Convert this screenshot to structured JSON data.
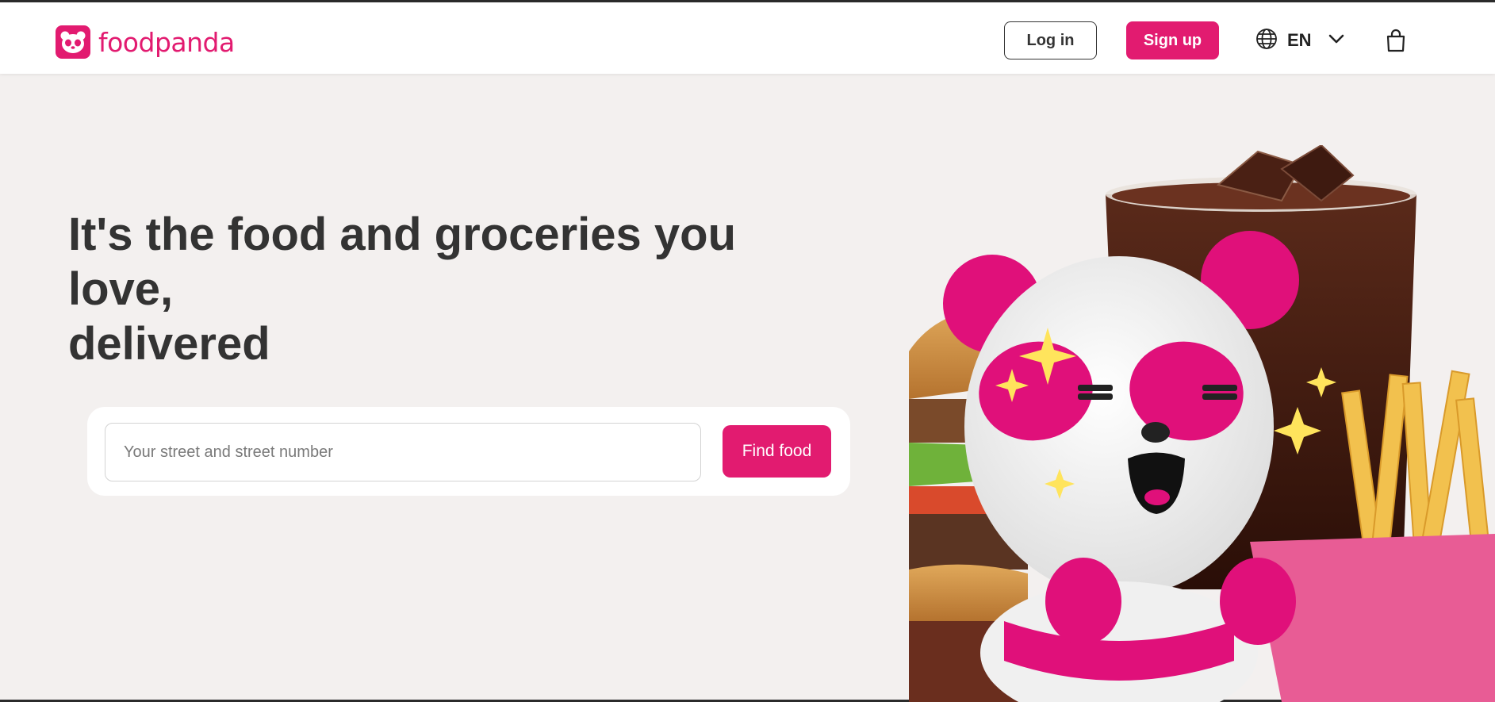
{
  "header": {
    "brand": "foodpanda",
    "login_label": "Log in",
    "signup_label": "Sign up",
    "language_label": "EN",
    "icons": {
      "logo": "panda-logo-icon",
      "language": "globe-icon",
      "language_toggle": "chevron-down-icon",
      "cart": "shopping-bag-icon"
    }
  },
  "hero": {
    "headline_line1": "It's the food and groceries you love,",
    "headline_line2": "delivered",
    "search": {
      "placeholder": "Your street and street number",
      "value": "",
      "button_label": "Find food"
    },
    "illustration": "panda-mascot-with-burger-drink-fries"
  },
  "colors": {
    "brand": "#e21b70",
    "background": "#f3f0ef",
    "text": "#333333"
  }
}
